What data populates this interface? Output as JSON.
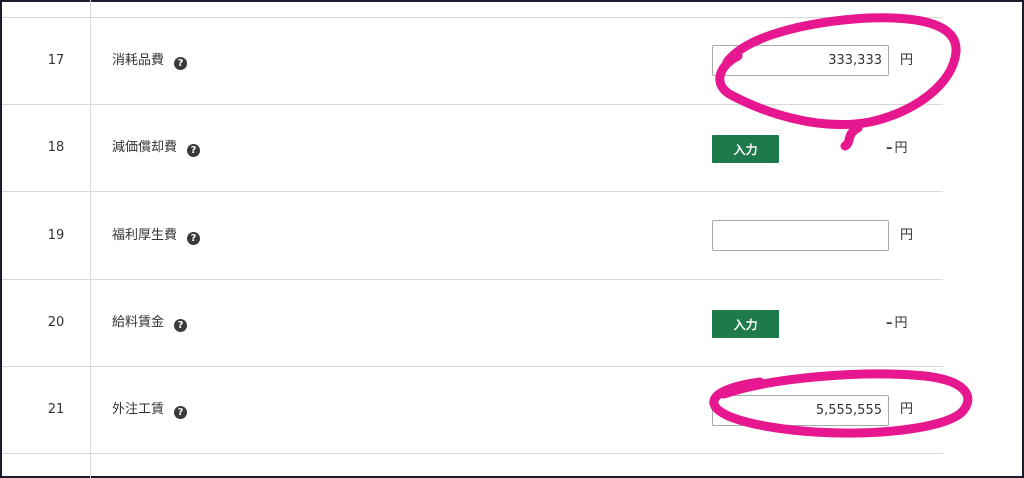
{
  "rows": [
    {
      "number": "17",
      "label": "消耗品費",
      "help": "?",
      "type": "field",
      "value": "333,333",
      "unit": "円"
    },
    {
      "number": "18",
      "label": "減価償却費",
      "help": "?",
      "type": "button",
      "button_label": "入力",
      "dash": "–",
      "unit": "円"
    },
    {
      "number": "19",
      "label": "福利厚生費",
      "help": "?",
      "type": "field",
      "value": "",
      "unit": "円"
    },
    {
      "number": "20",
      "label": "給料賃金",
      "help": "?",
      "type": "button",
      "button_label": "入力",
      "dash": "–",
      "unit": "円"
    },
    {
      "number": "21",
      "label": "外注工賃",
      "help": "?",
      "type": "field",
      "value": "5,555,555",
      "unit": "円"
    }
  ],
  "colors": {
    "accent_button": "#1e7a4a",
    "annotation": "#e6178f",
    "frame": "#1c1c2e",
    "divider": "#d8d8d8"
  },
  "icons": {
    "help": "question-circle-icon"
  }
}
